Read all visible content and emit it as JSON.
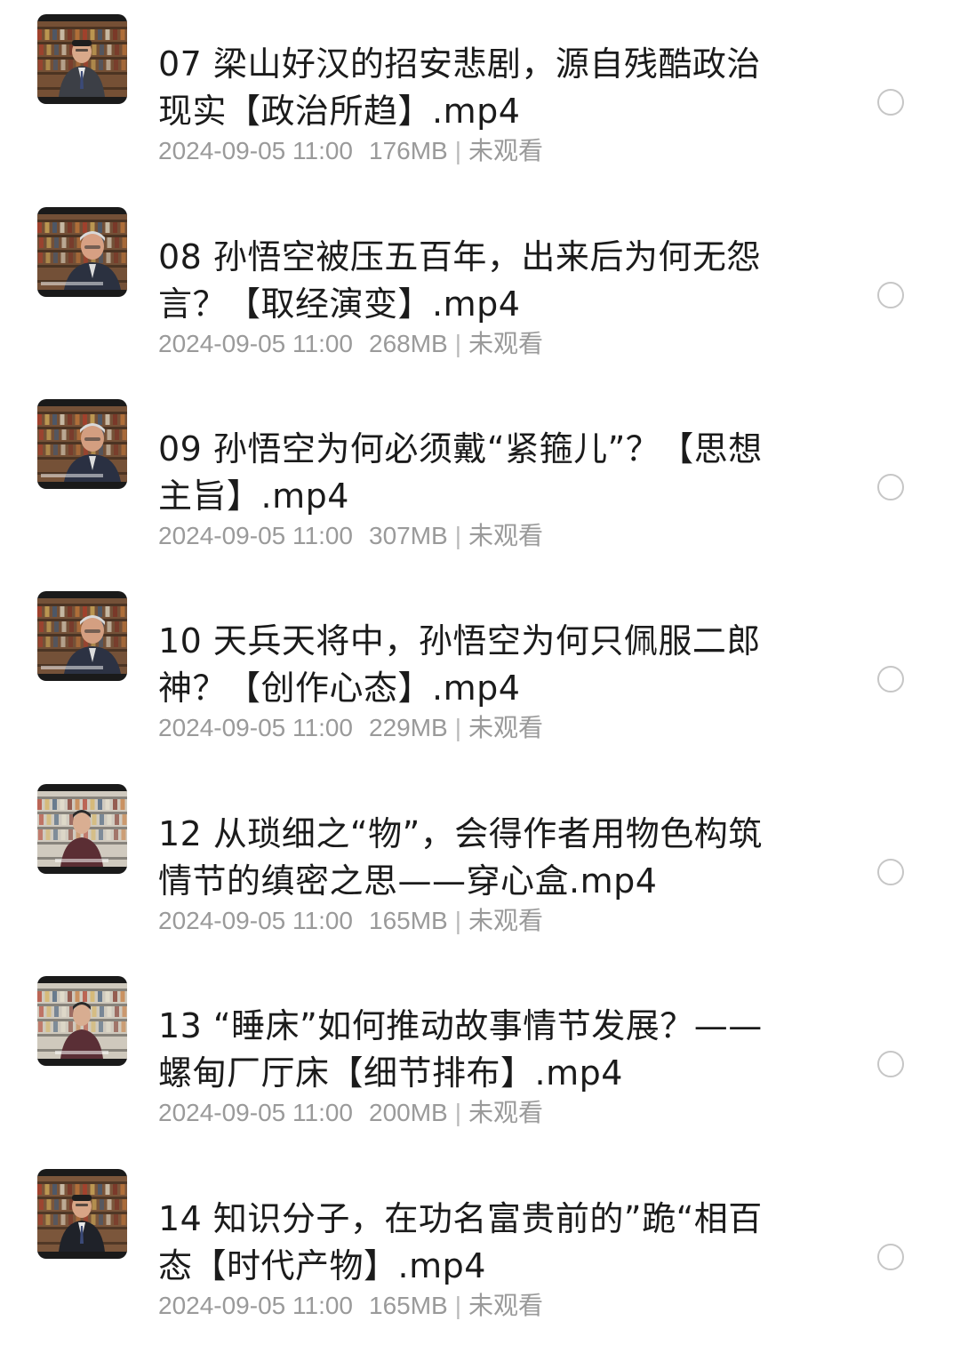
{
  "files": [
    {
      "title": "07 梁山好汉的招安悲剧，源自残酷政治\n现实【政治所趋】.mp4",
      "date": "2024-09-05 11:00",
      "size": "176MB",
      "separator": "|",
      "status": "未观看",
      "thumbnail_icon": "video-thumbnail-icon"
    },
    {
      "title": "08 孙悟空被压五百年，出来后为何无怨\n言？【取经演变】.mp4",
      "date": "2024-09-05 11:00",
      "size": "268MB",
      "separator": "|",
      "status": "未观看",
      "thumbnail_icon": "video-thumbnail-icon"
    },
    {
      "title": "09 孙悟空为何必须戴“紧箍儿”？【思想\n主旨】.mp4",
      "date": "2024-09-05 11:00",
      "size": "307MB",
      "separator": "|",
      "status": "未观看",
      "thumbnail_icon": "video-thumbnail-icon"
    },
    {
      "title": "10 天兵天将中，孙悟空为何只佩服二郎\n神？【创作心态】.mp4",
      "date": "2024-09-05 11:00",
      "size": "229MB",
      "separator": "|",
      "status": "未观看",
      "thumbnail_icon": "video-thumbnail-icon"
    },
    {
      "title": "12 从琐细之“物”，会得作者用物色构筑\n情节的缜密之思——穿心盒.mp4",
      "date": "2024-09-05 11:00",
      "size": "165MB",
      "separator": "|",
      "status": "未观看",
      "thumbnail_icon": "video-thumbnail-icon"
    },
    {
      "title": "13 “睡床”如何推动故事情节发展？——\n螺甸厂厅床【细节排布】.mp4",
      "date": "2024-09-05 11:00",
      "size": "200MB",
      "separator": "|",
      "status": "未观看",
      "thumbnail_icon": "video-thumbnail-icon"
    },
    {
      "title": "14 知识分子，在功名富贵前的”跪“相百\n态【时代产物】.mp4",
      "date": "2024-09-05 11:00",
      "size": "165MB",
      "separator": "|",
      "status": "未观看",
      "thumbnail_icon": "video-thumbnail-icon"
    }
  ],
  "colors": {
    "title_text": "#1b1b1b",
    "meta_text": "#9a9a9a",
    "select_circle_border": "#c6c6c6",
    "background": "#ffffff"
  }
}
